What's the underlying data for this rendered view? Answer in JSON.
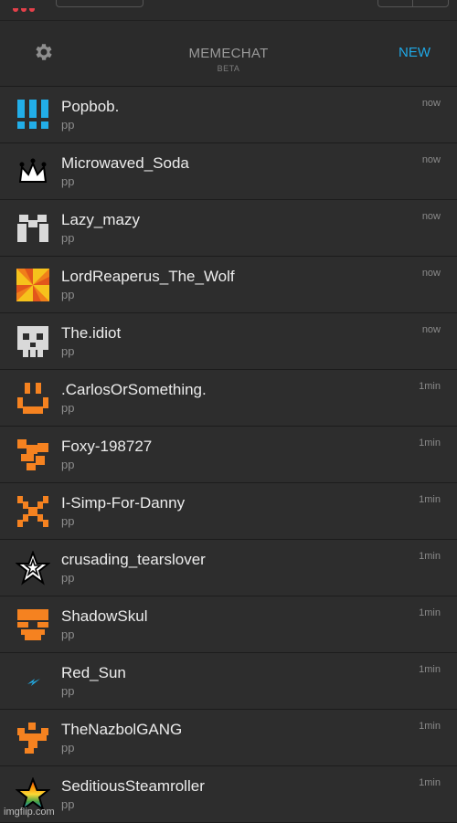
{
  "header": {
    "title": "MEMECHAT",
    "subtitle": "BETA",
    "new_label": "NEW",
    "accent": "#1fa8e6"
  },
  "chats": [
    {
      "name": "Popbob.",
      "preview": "pp",
      "time": "now",
      "avatar": "blue-bars-icon"
    },
    {
      "name": "Microwaved_Soda",
      "preview": "pp",
      "time": "now",
      "avatar": "crown-icon"
    },
    {
      "name": "Lazy_mazy",
      "preview": "pp",
      "time": "now",
      "avatar": "white-pixel-mask-icon"
    },
    {
      "name": "LordReaperus_The_Wolf",
      "preview": "pp",
      "time": "now",
      "avatar": "pinwheel-icon"
    },
    {
      "name": "The.idiot",
      "preview": "pp",
      "time": "now",
      "avatar": "white-skull-icon"
    },
    {
      "name": ".CarlosOrSomething.",
      "preview": "pp",
      "time": "1min",
      "avatar": "orange-smile-icon"
    },
    {
      "name": "Foxy-198727",
      "preview": "pp",
      "time": "1min",
      "avatar": "orange-pixel-icon"
    },
    {
      "name": "I-Simp-For-Danny",
      "preview": "pp",
      "time": "1min",
      "avatar": "orange-creeper-icon"
    },
    {
      "name": "crusading_tearslover",
      "preview": "pp",
      "time": "1min",
      "avatar": "star-outline-icon"
    },
    {
      "name": "ShadowSkul",
      "preview": "pp",
      "time": "1min",
      "avatar": "orange-skull-icon"
    },
    {
      "name": "Red_Sun",
      "preview": "pp",
      "time": "1min",
      "avatar": "blue-lightning-icon"
    },
    {
      "name": "TheNazbolGANG",
      "preview": "pp",
      "time": "1min",
      "avatar": "orange-totem-icon"
    },
    {
      "name": "SeditiousSteamroller",
      "preview": "pp",
      "time": "1min",
      "avatar": "rainbow-star-icon"
    }
  ],
  "watermark": "imgflip.com"
}
